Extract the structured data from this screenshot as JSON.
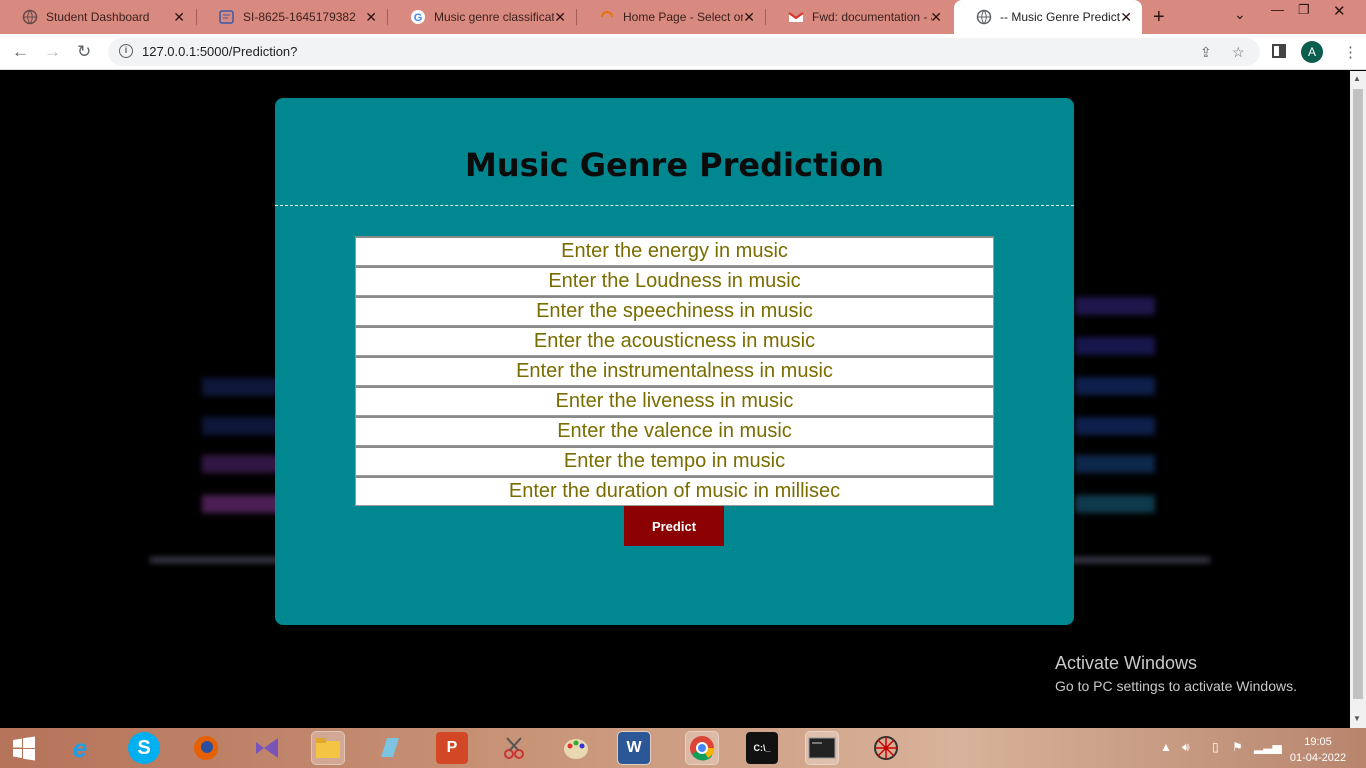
{
  "browser": {
    "tabs": [
      {
        "title": "Student Dashboard",
        "icon": "globe-icon"
      },
      {
        "title": "SI-8625-1645179382",
        "icon": "document-icon"
      },
      {
        "title": "Music genre classificatio",
        "icon": "google-icon"
      },
      {
        "title": "Home Page - Select or",
        "icon": "loading-icon"
      },
      {
        "title": "Fwd: documentation - a",
        "icon": "gmail-icon"
      },
      {
        "title": "-- Music Genre Predictio",
        "icon": "globe-icon"
      }
    ],
    "url": "127.0.0.1:5000/Prediction?",
    "profile_initial": "A"
  },
  "page": {
    "title": "Music Genre Prediction",
    "fields": [
      {
        "placeholder": "Enter the energy in music"
      },
      {
        "placeholder": "Enter the Loudness in music"
      },
      {
        "placeholder": "Enter the speechiness in music"
      },
      {
        "placeholder": "Enter the acousticness in music"
      },
      {
        "placeholder": "Enter the instrumentalness in music"
      },
      {
        "placeholder": "Enter the liveness in music"
      },
      {
        "placeholder": "Enter the valence in music"
      },
      {
        "placeholder": "Enter the tempo in music"
      },
      {
        "placeholder": "Enter the duration of music in millisec"
      }
    ],
    "submit_label": "Predict",
    "colors": {
      "card": "#00878f",
      "button": "#8b0000",
      "placeholder": "#7a6d00"
    }
  },
  "watermark": {
    "line1": "Activate Windows",
    "line2": "Go to PC settings to activate Windows."
  },
  "taskbar": {
    "time": "19:05",
    "date": "01-04-2022"
  }
}
